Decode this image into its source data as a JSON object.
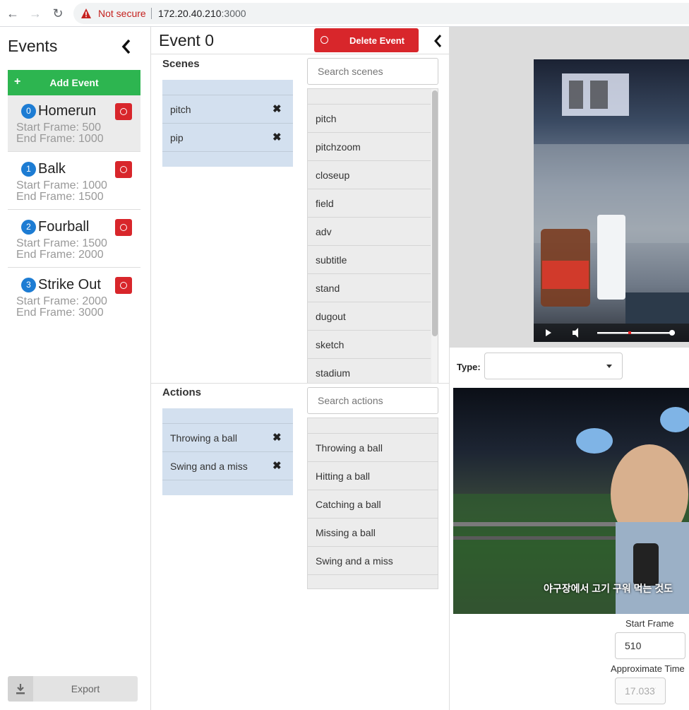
{
  "browser": {
    "not_secure": "Not secure",
    "url_host": "172.20.40.210",
    "url_port": ":3000"
  },
  "events_panel": {
    "title": "Events",
    "add_label": "Add Event",
    "export_label": "Export",
    "items": [
      {
        "index": "0",
        "name": "Homerun",
        "start": "Start Frame: 500",
        "end": "End Frame: 1000"
      },
      {
        "index": "1",
        "name": "Balk",
        "start": "Start Frame: 1000",
        "end": "End Frame: 1500"
      },
      {
        "index": "2",
        "name": "Fourball",
        "start": "Start Frame: 1500",
        "end": "End Frame: 2000"
      },
      {
        "index": "3",
        "name": "Strike Out",
        "start": "Start Frame: 2000",
        "end": "End Frame: 3000"
      }
    ]
  },
  "editor": {
    "title": "Event 0",
    "delete_label": "Delete Event",
    "scenes": {
      "title": "Scenes",
      "search_placeholder": "Search scenes",
      "selected": [
        "pitch",
        "pip"
      ],
      "options": [
        "pitch",
        "pitchzoom",
        "closeup",
        "field",
        "adv",
        "subtitle",
        "stand",
        "dugout",
        "sketch",
        "stadium"
      ]
    },
    "actions": {
      "title": "Actions",
      "search_placeholder": "Search actions",
      "selected": [
        "Throwing a ball",
        "Swing and a miss"
      ],
      "options": [
        "Throwing a ball",
        "Hitting a ball",
        "Catching a ball",
        "Missing a ball",
        "Swing and a miss"
      ]
    }
  },
  "preview": {
    "type_label": "Type:",
    "subtitle_text": "야구장에서 고기 구워 먹는 것도",
    "start_frame_label": "Start Frame",
    "start_frame_value": "510",
    "approx_time_label": "Approximate Time",
    "approx_time_value": "17.0337"
  },
  "colors": {
    "add_green": "#2db550",
    "delete_red": "#d8262b",
    "badge_blue": "#1d7cd3",
    "selected_bg": "#d3e0ef"
  }
}
